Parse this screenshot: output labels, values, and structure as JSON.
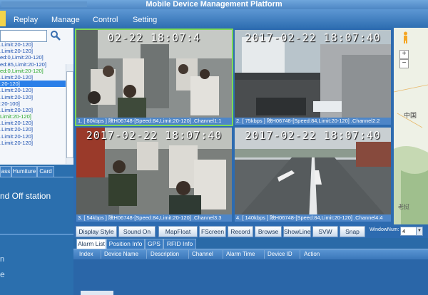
{
  "window": {
    "title": "Mobile Device Management Platform"
  },
  "menu": [
    "Replay",
    "Manage",
    "Control",
    "Setting"
  ],
  "tree": {
    "items": [
      {
        "label": ".Limit:20-120]",
        "color": "blue"
      },
      {
        "label": ".Limit:20-120]",
        "color": "blue"
      },
      {
        "label": "ed:0,Limit:20-120]",
        "color": "blue"
      },
      {
        "label": "ed:85,Limit:20-120]",
        "color": "blue"
      },
      {
        "label": "ed:0,Limit:20-120]",
        "color": "green"
      },
      {
        "label": ".Limit:20-120]",
        "color": "blue"
      },
      {
        "label": ":20-120]",
        "color": "selected"
      },
      {
        "label": ".Limit:20-120]",
        "color": "blue"
      },
      {
        "label": ".Limit:20-120]",
        "color": "blue"
      },
      {
        "label": ":20-100]",
        "color": "blue"
      },
      {
        "label": ".Limit:20-120]",
        "color": "blue"
      },
      {
        "label": "Limit:20-120]",
        "color": "green"
      },
      {
        "label": ".Limit:20-120]",
        "color": "blue"
      },
      {
        "label": ".Limit:20-120]",
        "color": "blue"
      },
      {
        "label": ".Limit:20-120]",
        "color": "blue"
      },
      {
        "label": ".Limit:20-120]",
        "color": "blue"
      }
    ]
  },
  "left_tabs": [
    "ass",
    "Humiture",
    "Card"
  ],
  "left_content": {
    "text": "nd Off station",
    "glyph1": "n",
    "glyph2": "e"
  },
  "cameras": [
    {
      "stamp": "02-22  18:07:4",
      "caption": "1. [ 80kbps ] 陕H06748-[Speed:84,Limit:20-120] .Channel1:1"
    },
    {
      "stamp": "2017-02-22  18:07:40",
      "caption": "2. [ 75kbps ] 陕H06748-[Speed:84,Limit:20-120] .Channel2:2"
    },
    {
      "stamp": "2017-02-22  18:07:40",
      "caption": "3. [ 54kbps ] 陕H06748-[Speed:84,Limit:20-120] .Channel3:3"
    },
    {
      "stamp": "2017-02-22  18:07:40",
      "caption": "4. [ 140kbps ] 陕H06748-[Speed:84,Limit:20-120] .Channel4:4"
    }
  ],
  "toolbar": {
    "buttons": [
      "Display Style",
      "Sound On",
      "MapFloat",
      "FScreen",
      "Record",
      "Browse",
      "ShowLine",
      "SVW",
      "Snap"
    ],
    "window_num_label": "WindowNum:",
    "window_num_value": "4"
  },
  "alarm_tabs": [
    "Alarm List",
    "Position Info",
    "GPS",
    "RFID Info"
  ],
  "alarm_columns": [
    "Index",
    "Device Name",
    "Description",
    "Channel",
    "Alarm Time",
    "Device ID",
    "Action"
  ],
  "map": {
    "city1": "中国",
    "city2": "老挝"
  },
  "colors": {
    "accent": "#2d6bb0",
    "selected_green": "#7ed957",
    "tree_blue": "#1a4fb0",
    "tree_green": "#29a829"
  }
}
